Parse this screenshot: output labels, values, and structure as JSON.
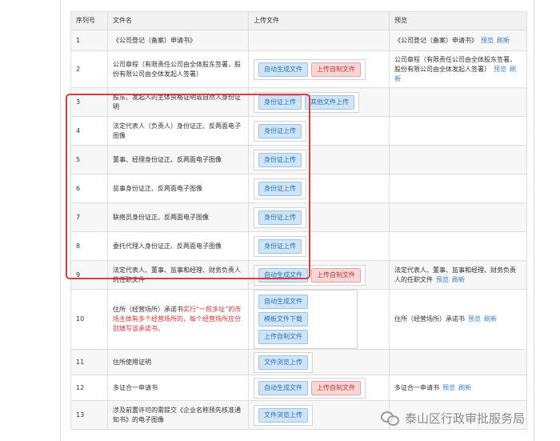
{
  "headers": {
    "seq": "序列号",
    "name": "文件名",
    "upload": "上传文件",
    "preview": "预览"
  },
  "rows": [
    {
      "seq": "1",
      "name": "《公司登记（备案）申请书》",
      "buttons": [],
      "preview": "《公司登记（备案）申请书》",
      "links": [
        "预览",
        "刷新"
      ]
    },
    {
      "seq": "2",
      "name": "公司章程（有限责任公司由全体股东签署，股份有限公司由全体发起人签署）",
      "buttons": [
        {
          "label": "自动生成文件",
          "style": "blue"
        },
        {
          "label": "上传自制文件",
          "style": "red"
        }
      ],
      "preview": "公司章程（有限责任公司由全体股东签署，股份有限公司由全体发起人签署）",
      "links": [
        "预览",
        "刷新"
      ]
    },
    {
      "seq": "3",
      "name": "股东、发起人的主体资格证明或自然人身份证明",
      "buttons": [
        {
          "label": "身份证上传",
          "style": "blue"
        },
        {
          "label": "其他文件上传",
          "style": "blue"
        }
      ],
      "preview": "",
      "links": []
    },
    {
      "seq": "4",
      "name": "法定代表人（负责人）身份证正、反两面电子图像",
      "buttons": [
        {
          "label": "身份证上传",
          "style": "blue"
        }
      ],
      "preview": "",
      "links": []
    },
    {
      "seq": "5",
      "name": "董事、经理身份证正、反两面电子图像",
      "buttons": [
        {
          "label": "身份证上传",
          "style": "blue"
        }
      ],
      "preview": "",
      "links": []
    },
    {
      "seq": "6",
      "name": "监事身份证正、反两面电子图像",
      "buttons": [
        {
          "label": "身份证上传",
          "style": "blue"
        }
      ],
      "preview": "",
      "links": []
    },
    {
      "seq": "7",
      "name": "联络员身份证正、反两面电子图像",
      "buttons": [
        {
          "label": "身份证上传",
          "style": "blue"
        }
      ],
      "preview": "",
      "links": []
    },
    {
      "seq": "8",
      "name": "委托代理人身份证正、反两面电子图像",
      "buttons": [
        {
          "label": "身份证上传",
          "style": "blue"
        }
      ],
      "preview": "",
      "links": []
    },
    {
      "seq": "9",
      "name": "法定代表人、董事、监事和经理、财务负责人的任职文件",
      "buttons": [
        {
          "label": "自动生成文件",
          "style": "blue"
        },
        {
          "label": "上传自制文件",
          "style": "red"
        }
      ],
      "preview": "法定代表人、董事、监事和经理、财务负责人的任职文件",
      "links": [
        "预览",
        "刷新"
      ]
    },
    {
      "seq": "10",
      "name_pre": "住所（经营场所）承诺书",
      "name_red": "实行“一照多址”的市场主体有多个经营场所的，每个经营场所应分别填写该承诺书。",
      "buttons": [
        {
          "label": "自动生成文件",
          "style": "blue"
        },
        {
          "label": "模板文件下载",
          "style": "blue"
        },
        {
          "label": "上传自制文件",
          "style": "blue"
        }
      ],
      "preview": "住所（经营场所）承诺书",
      "links": [
        "预览",
        "刷新"
      ]
    },
    {
      "seq": "11",
      "name": "住所使用证明",
      "buttons": [
        {
          "label": "文件浏览上传",
          "style": "blue"
        }
      ],
      "preview": "",
      "links": []
    },
    {
      "seq": "12",
      "name": "多证合一申请书",
      "buttons": [
        {
          "label": "自动生成文件",
          "style": "blue"
        },
        {
          "label": "上传自制文件",
          "style": "red"
        }
      ],
      "preview": "多证合一申请书",
      "links": [
        "预览",
        "刷新"
      ]
    },
    {
      "seq": "13",
      "name": "涉及前置许可的需提交《企业名称预先核准通知书》的电子图像",
      "buttons": [
        {
          "label": "文件浏览上传",
          "style": "blue"
        }
      ],
      "preview": "",
      "links": []
    }
  ],
  "watermark": {
    "text": "泰山区行政审批服务局",
    "icon": "wechat-icon"
  },
  "colors": {
    "highlight_border": "#e23a3a",
    "button_blue": "#cfe5f7",
    "button_red": "#f7d6d6",
    "link": "#3b7fc4"
  }
}
